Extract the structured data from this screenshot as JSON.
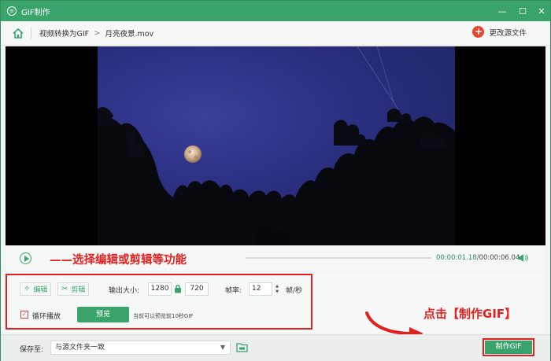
{
  "window": {
    "title": "GIF制作",
    "app_icon": "gif-logo-icon"
  },
  "breadcrumb": {
    "home_icon": "home-icon",
    "parent": "视频转换为GIF",
    "separator": ">",
    "current": "月亮夜景.mov"
  },
  "header": {
    "change_source_label": "更改源文件"
  },
  "playback": {
    "annotation": "——选择编辑或剪辑等功能",
    "current_time": "00:00:01.18",
    "separator": "/",
    "total_time": "00:00:06.04",
    "progress": 0.0
  },
  "settings": {
    "edit_label": "编辑",
    "trim_label": "剪辑",
    "output_size_label": "输出大小:",
    "width": "1280",
    "height": "720",
    "framerate_label": "帧率:",
    "framerate": "12",
    "framerate_unit": "帧/秒",
    "loop_label": "循环播放",
    "loop_checked": true,
    "preview_label": "预览",
    "preview_hint": "当前可以预览前10秒GIF"
  },
  "annotation_click": "点击【制作GIF】",
  "save": {
    "label": "保存至:",
    "selected": "与源文件夹一致",
    "make_gif_label": "制作GIF"
  },
  "colors": {
    "accent": "#3aa36c",
    "annotation": "#e32222",
    "sky": "#2a2e7e"
  }
}
